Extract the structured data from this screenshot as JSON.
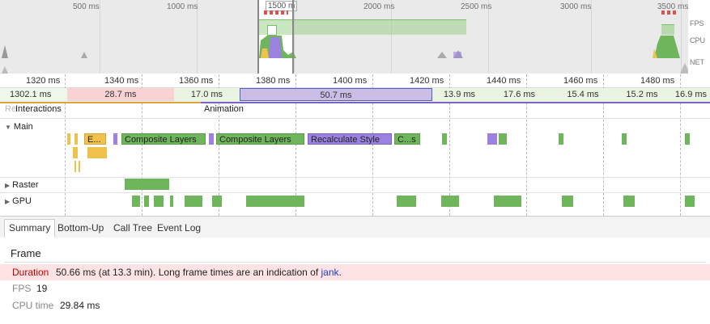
{
  "overview": {
    "tick_labels": [
      "500 ms",
      "1000 ms",
      "1500 m",
      "2000 ms",
      "2500 ms",
      "3000 ms",
      "3500 ms"
    ],
    "lanes": [
      "FPS",
      "CPU",
      "NET"
    ]
  },
  "ruler": {
    "labels": [
      "1320 ms",
      "1340 ms",
      "1360 ms",
      "1380 ms",
      "1400 ms",
      "1420 ms",
      "1440 ms",
      "1460 ms",
      "1480 ms"
    ]
  },
  "frames": [
    "1302.1 ms",
    "28.7 ms",
    "17.0 ms",
    "50.7 ms",
    "13.9 ms",
    "17.6 ms",
    "15.4 ms",
    "15.2 ms",
    "16.9 ms"
  ],
  "tracks": {
    "interactions_label": "Interactions",
    "interactions_prefix": "Re",
    "animation_label": "Animation",
    "main_label": "Main",
    "raster_label": "Raster",
    "gpu_label": "GPU"
  },
  "main_blocks": {
    "e1": "E...",
    "composite1": "Composite Layers",
    "composite2": "Composite Layers",
    "recalc": "Recalculate Style",
    "cs": "C...s"
  },
  "tabs": [
    "Summary",
    "Bottom-Up",
    "Call Tree",
    "Event Log"
  ],
  "summary": {
    "title": "Frame",
    "duration_key": "Duration",
    "duration_value": "50.66 ms (at 13.3 min). Long frame times are an indication of",
    "duration_link": "jank",
    "duration_end": ".",
    "fps_key": "FPS",
    "fps_value": "19",
    "cpu_key": "CPU time",
    "cpu_value": "29.84 ms"
  },
  "colors": {
    "green": "#6fb55c",
    "purple": "#9b82e0",
    "yellow": "#f0c14b",
    "red_frame": "#f9d3d3",
    "link": "#1a3ec7",
    "duration_key": "#c00000"
  }
}
